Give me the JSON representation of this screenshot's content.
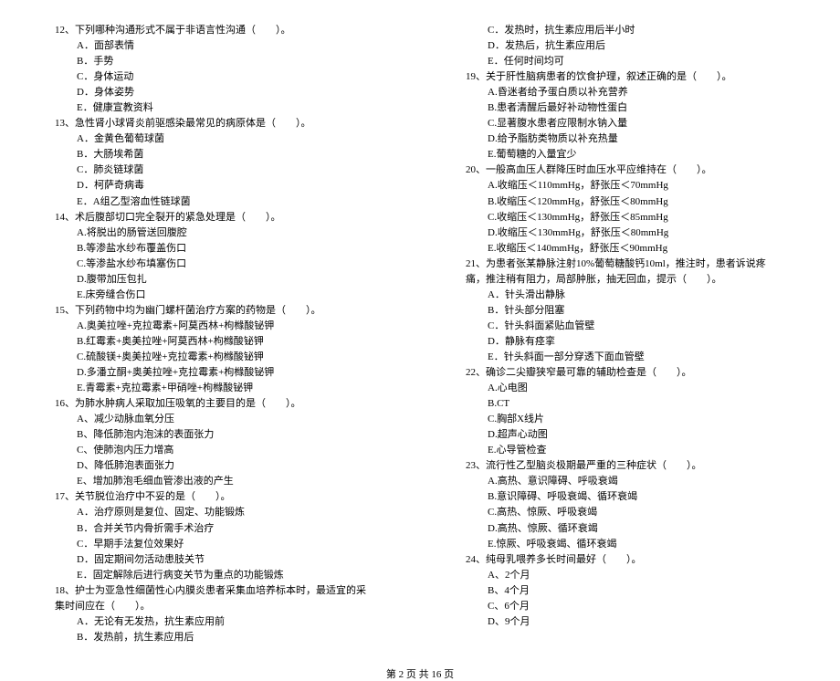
{
  "footer": "第 2 页 共 16 页",
  "left": {
    "q12": {
      "title": "12、下列哪种沟通形式不属于非语言性沟通（　　）。",
      "opts": [
        "A．面部表情",
        "B．手势",
        "C．身体运动",
        "D．身体姿势",
        "E．健康宣教资料"
      ]
    },
    "q13": {
      "title": "13、急性肾小球肾炎前驱感染最常见的病原体是（　　）。",
      "opts": [
        "A．金黄色葡萄球菌",
        "B．大肠埃希菌",
        "C．肺炎链球菌",
        "D．柯萨奇病毒",
        "E．A组乙型溶血性链球菌"
      ]
    },
    "q14": {
      "title": "14、术后腹部切口完全裂开的紧急处理是（　　）。",
      "opts": [
        "A.将脱出的肠管送回腹腔",
        "B.等渗盐水纱布覆盖伤口",
        "C.等渗盐水纱布填塞伤口",
        "D.腹带加压包扎",
        "E.床旁缝合伤口"
      ]
    },
    "q15": {
      "title": "15、下列药物中均为幽门螺杆菌治疗方案的药物是（　　）。",
      "opts": [
        "A.奥美拉唑+克拉霉素+阿莫西林+枸橼酸铋钾",
        "B.红霉素+奥美拉唑+阿莫西林+枸橼酸铋钾",
        "C.硫酸镁+奥美拉唑+克拉霉素+枸橼酸铋钾",
        "D.多潘立酮+奥美拉唑+克拉霉素+枸橼酸铋钾",
        "E.青霉素+克拉霉素+甲硝唑+枸橼酸铋钾"
      ]
    },
    "q16": {
      "title": "16、为肺水肿病人采取加压吸氧的主要目的是（　　）。",
      "opts": [
        "A、减少动脉血氧分压",
        "B、降低肺泡内泡沫的表面张力",
        "C、使肺泡内压力增高",
        "D、降低肺泡表面张力",
        "E、增加肺泡毛细血管渗出液的产生"
      ]
    },
    "q17": {
      "title": "17、关节脱位治疗中不妥的是（　　）。",
      "opts": [
        "A．治疗原则是复位、固定、功能锻炼",
        "B．合并关节内骨折需手术治疗",
        "C．早期手法复位效果好",
        "D．固定期间勿活动患肢关节",
        "E．固定解除后进行病变关节为重点的功能锻炼"
      ]
    },
    "q18": {
      "title": "18、护士为亚急性细菌性心内膜炎患者采集血培养标本时，最适宜的采集时间应在（　　）。",
      "opts": [
        "A．无论有无发热，抗生素应用前",
        "B．发热前，抗生素应用后"
      ]
    }
  },
  "right": {
    "q18c": {
      "opts": [
        "C．发热时，抗生素应用后半小时",
        "D．发热后，抗生素应用后",
        "E．任何时间均可"
      ]
    },
    "q19": {
      "title": "19、关于肝性脑病患者的饮食护理，叙述正确的是（　　）。",
      "opts": [
        "A.昏迷者给予蛋白质以补充营养",
        "B.患者清醒后最好补动物性蛋白",
        "C.显著腹水患者应限制水钠入量",
        "D.给予脂肪类物质以补充热量",
        "E.葡萄糖的入量宜少"
      ]
    },
    "q20": {
      "title": "20、一般高血压人群降压时血压水平应维持在（　　）。",
      "opts": [
        "A.收缩压＜110mmHg，舒张压＜70mmHg",
        "B.收缩压＜120mmHg，舒张压＜80mmHg",
        "C.收缩压＜130mmHg，舒张压＜85mmHg",
        "D.收缩压＜130mmHg，舒张压＜80mmHg",
        "E.收缩压＜140mmHg，舒张压＜90mmHg"
      ]
    },
    "q21": {
      "title": "21、为患者张某静脉注射10%葡萄糖酸钙10ml，推注时，患者诉说疼痛，推注稍有阻力，局部肿胀，抽无回血，提示（　　）。",
      "opts": [
        "A．针头滑出静脉",
        "B．针头部分阻塞",
        "C．针头斜面紧贴血管壁",
        "D．静脉有痉挛",
        "E．针头斜面一部分穿透下面血管壁"
      ]
    },
    "q22": {
      "title": "22、确诊二尖瓣狭窄最可靠的辅助检查是（　　）。",
      "opts": [
        "A.心电图",
        "B.CT",
        "C.胸部X线片",
        "D.超声心动图",
        "E.心导管检查"
      ]
    },
    "q23": {
      "title": "23、流行性乙型脑炎极期最严重的三种症状（　　）。",
      "opts": [
        "A.高热、意识障碍、呼吸衰竭",
        "B.意识障碍、呼吸衰竭、循环衰竭",
        "C.高热、惊厥、呼吸衰竭",
        "D.高热、惊厥、循环衰竭",
        "E.惊厥、呼吸衰竭、循环衰竭"
      ]
    },
    "q24": {
      "title": "24、纯母乳喂养多长时间最好（　　）。",
      "opts": [
        "A、2个月",
        "B、4个月",
        "C、6个月",
        "D、9个月"
      ]
    }
  }
}
